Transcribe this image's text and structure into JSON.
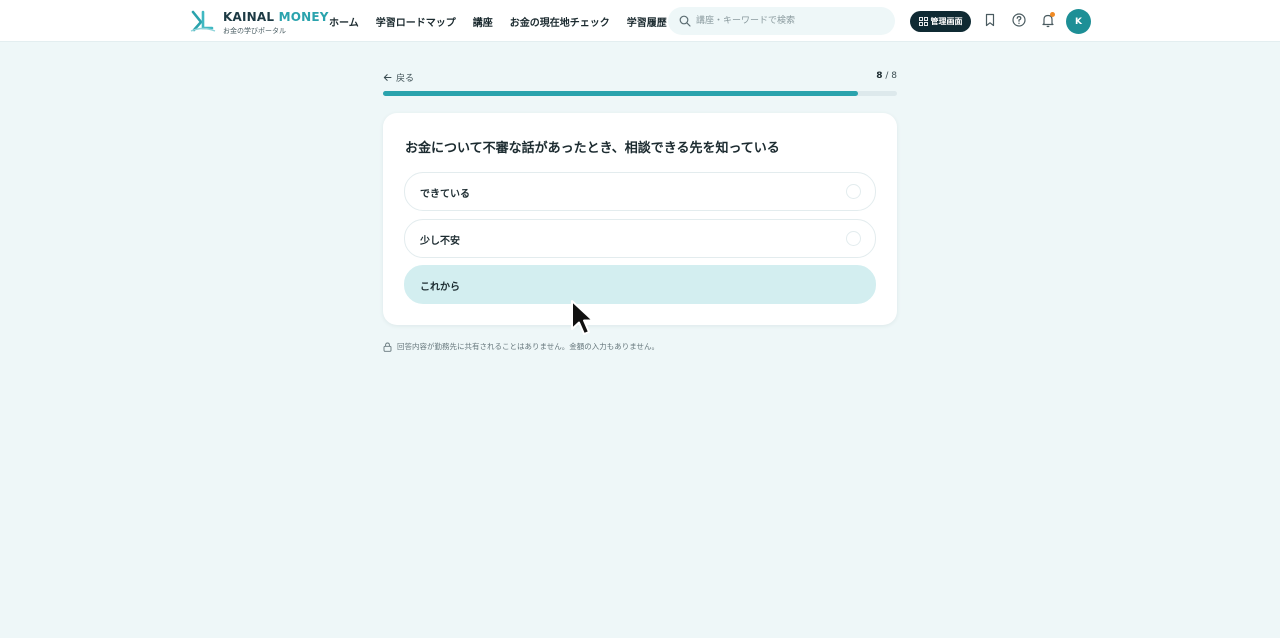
{
  "header": {
    "logo": {
      "title_a": "KAINAL",
      "title_b": "MONEY",
      "subtitle": "お金の学びポータル"
    },
    "nav": [
      "ホーム",
      "学習ロードマップ",
      "講座",
      "お金の現在地チェック",
      "学習履歴"
    ],
    "search": {
      "placeholder": "講座・キーワードで検索",
      "value": ""
    },
    "admin_label": "管理画面",
    "avatar_initial": "K",
    "notification_badge": true,
    "icons": [
      "bookmark-icon",
      "help-icon",
      "bell-icon",
      "search-icon",
      "grid-icon"
    ]
  },
  "progress": {
    "back_label": "戻る",
    "current": "8",
    "separator": " / ",
    "total": "8",
    "fill_fraction": 0.925
  },
  "question": {
    "text": "お金について不審な話があったとき、相談できる先を知っている",
    "options": [
      {
        "label": "できている",
        "selected": false
      },
      {
        "label": "少し不安",
        "selected": false
      },
      {
        "label": "これから",
        "selected": true
      }
    ]
  },
  "privacy_note": "回答内容が勤務先に共有されることはありません。金額の入力もありません。",
  "colors": {
    "accent": "#2aa3ad",
    "selected_option": "#d3eef0",
    "background": "#eef7f8",
    "admin_button": "#0f2a33",
    "notification_dot": "#f08a24"
  }
}
